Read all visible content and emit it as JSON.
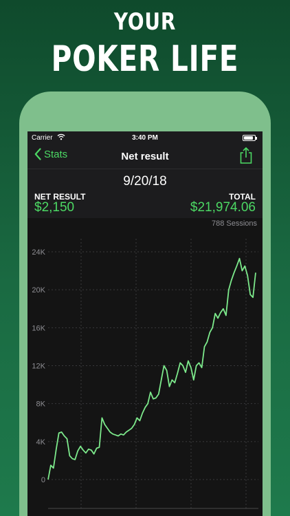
{
  "headline": {
    "line1": "YOUR",
    "line2": "POKER LIFE"
  },
  "status_bar": {
    "carrier": "Carrier",
    "time": "3:40 PM"
  },
  "nav": {
    "back_label": "Stats",
    "title": "Net result"
  },
  "summary": {
    "date": "9/20/18",
    "net_label": "NET RESULT",
    "net_value": "$2,150",
    "total_label": "TOTAL",
    "total_value": "$21,974.06",
    "sessions": "788 Sessions"
  },
  "colors": {
    "accent": "#4cd964",
    "background": "#1c1c1e",
    "device": "#7fbf8c"
  },
  "chart_data": {
    "type": "line",
    "y_tick_labels": [
      "0",
      "4K",
      "8K",
      "12K",
      "16K",
      "20K",
      "24K"
    ],
    "ylim": [
      -1000,
      25000
    ],
    "grid": true,
    "series": [
      {
        "values": [
          0,
          1500,
          1200,
          3200,
          4900,
          5000,
          4600,
          4300,
          2500,
          2200,
          2100,
          3000,
          3500,
          3100,
          2800,
          3200,
          3100,
          2700,
          3300,
          3400,
          6500,
          5800,
          5400,
          5000,
          4800,
          4700,
          4600,
          4800,
          4700,
          5000,
          5200,
          5400,
          5800,
          6500,
          6200,
          7000,
          7600,
          8000,
          9200,
          8500,
          8600,
          9000,
          10500,
          12000,
          11500,
          9800,
          10500,
          10200,
          11200,
          12300,
          12000,
          11300,
          12500,
          11800,
          10500,
          12000,
          12300,
          11800,
          14000,
          14500,
          15500,
          16000,
          17500,
          17000,
          17600,
          18000,
          17300,
          20000,
          21000,
          21800,
          22500,
          23300,
          22000,
          22500,
          21500,
          19500,
          19200,
          21800
        ]
      }
    ]
  }
}
